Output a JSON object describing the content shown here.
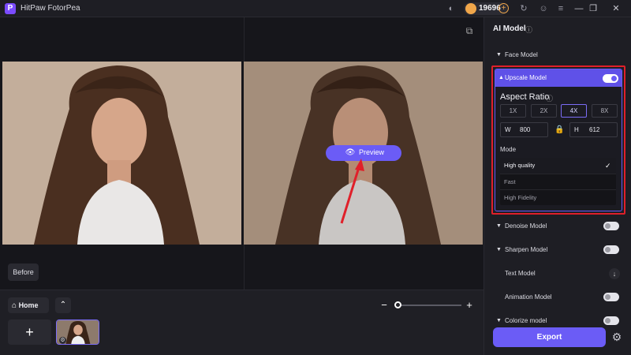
{
  "app": {
    "title": "HitPaw FotorPea",
    "logo_letter": "P"
  },
  "titlebar": {
    "coins": "19696",
    "coin_plus": "+",
    "minimize": "—",
    "maximize": "❐",
    "close": "✕",
    "discord_icon": "◐",
    "refresh_icon": "↻",
    "account_icon": "☺",
    "menu_icon": "≡"
  },
  "canvas": {
    "preview_label": "Preview",
    "before_label": "Before",
    "preview_icon": "👁",
    "crop_icon": "⧉"
  },
  "bottom": {
    "home_label": "Home",
    "home_icon": "⌂",
    "collapse_icon": "⌃",
    "zoom_minus": "−",
    "zoom_plus": "+",
    "zoom_level": 0.0,
    "add_label": "+",
    "thumb_settings_icon": "⚙"
  },
  "panel": {
    "title": "AI Model",
    "info_icon": "ⓘ",
    "face_model": "Face Model",
    "upscale": {
      "label": "Upscale Model",
      "enabled": true,
      "aspect_ratio_title": "Aspect Ratio",
      "scales": [
        "1X",
        "2X",
        "4X",
        "8X"
      ],
      "selected_scale": "4X",
      "width_label": "W",
      "width_value": "800",
      "height_label": "H",
      "height_value": "612",
      "lock_icon": "🔒",
      "mode_label": "Mode",
      "modes": [
        "High quality",
        "Fast",
        "High Fidelity"
      ],
      "selected_mode": "High quality",
      "check_icon": "✓"
    },
    "models": [
      {
        "label": "Denoise Model",
        "type": "toggle",
        "enabled": false
      },
      {
        "label": "Sharpen Model",
        "type": "toggle",
        "enabled": false
      },
      {
        "label": "Text Model",
        "type": "download"
      },
      {
        "label": "Animation Model",
        "type": "toggle",
        "enabled": false
      },
      {
        "label": "Colorize model",
        "type": "toggle",
        "enabled": false
      }
    ],
    "download_icon": "↓",
    "export_label": "Export",
    "settings_icon": "⚙"
  },
  "colors": {
    "accent": "#6b5cf6",
    "highlight_border": "#e0202a",
    "background": "#17171c",
    "coin": "#f0a64a"
  }
}
